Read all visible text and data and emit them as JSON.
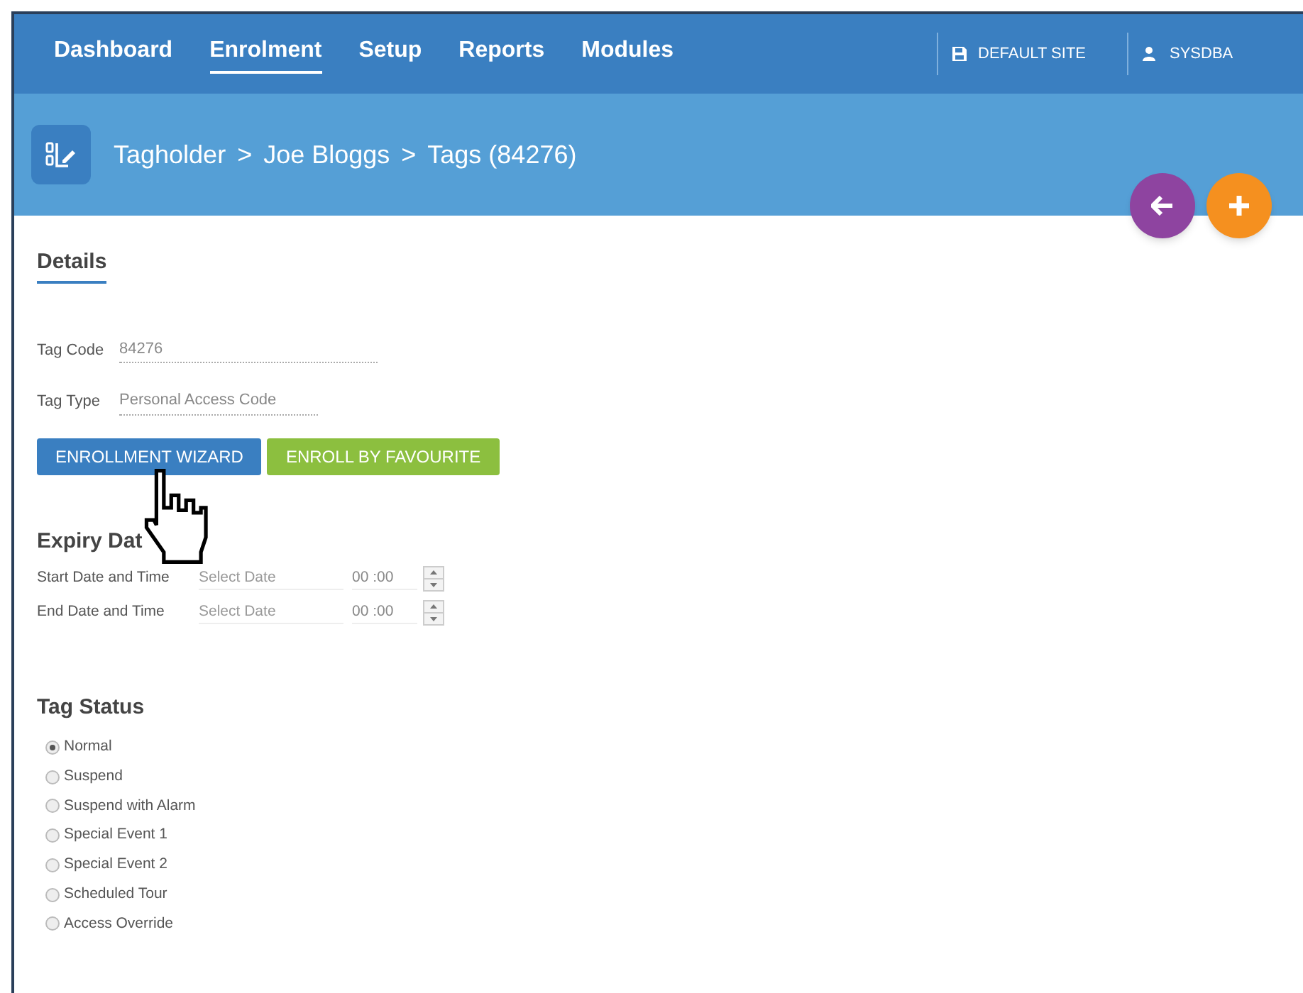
{
  "nav": {
    "items": [
      {
        "label": "Dashboard",
        "selected": false
      },
      {
        "label": "Enrolment",
        "selected": true
      },
      {
        "label": "Setup",
        "selected": false
      },
      {
        "label": "Reports",
        "selected": false
      },
      {
        "label": "Modules",
        "selected": false
      }
    ],
    "site": "DEFAULT SITE",
    "user": "SYSDBA"
  },
  "breadcrumb": [
    "Tagholder",
    "Joe Bloggs",
    "Tags (84276)"
  ],
  "breadcrumb_separator": ">",
  "section_tab": "Details",
  "fields": [
    {
      "label": "Tag Code",
      "value": "84276"
    },
    {
      "label": "Tag Type",
      "value": "Personal Access Code"
    }
  ],
  "buttons": [
    {
      "label": "ENROLLMENT WIZARD",
      "kind": "primary"
    },
    {
      "label": "ENROLL BY FAVOURITE",
      "kind": "success"
    }
  ],
  "expiry": {
    "heading": "Expiry Dat",
    "rows": [
      {
        "label": "Start Date and Time",
        "placeholder": "Select Date",
        "time": "00 :00"
      },
      {
        "label": "End Date and Time",
        "placeholder": "Select Date",
        "time": "00 :00"
      }
    ]
  },
  "status": {
    "heading": "Tag Status",
    "options": [
      {
        "label": "Normal",
        "selected": true
      },
      {
        "label": "Suspend",
        "selected": false
      },
      {
        "label": "Suspend with Alarm",
        "selected": false
      },
      {
        "label": "Special Event 1",
        "selected": false
      },
      {
        "label": "Special Event 2",
        "selected": false
      },
      {
        "label": "Scheduled Tour",
        "selected": false
      },
      {
        "label": "Access Override",
        "selected": false
      }
    ]
  }
}
